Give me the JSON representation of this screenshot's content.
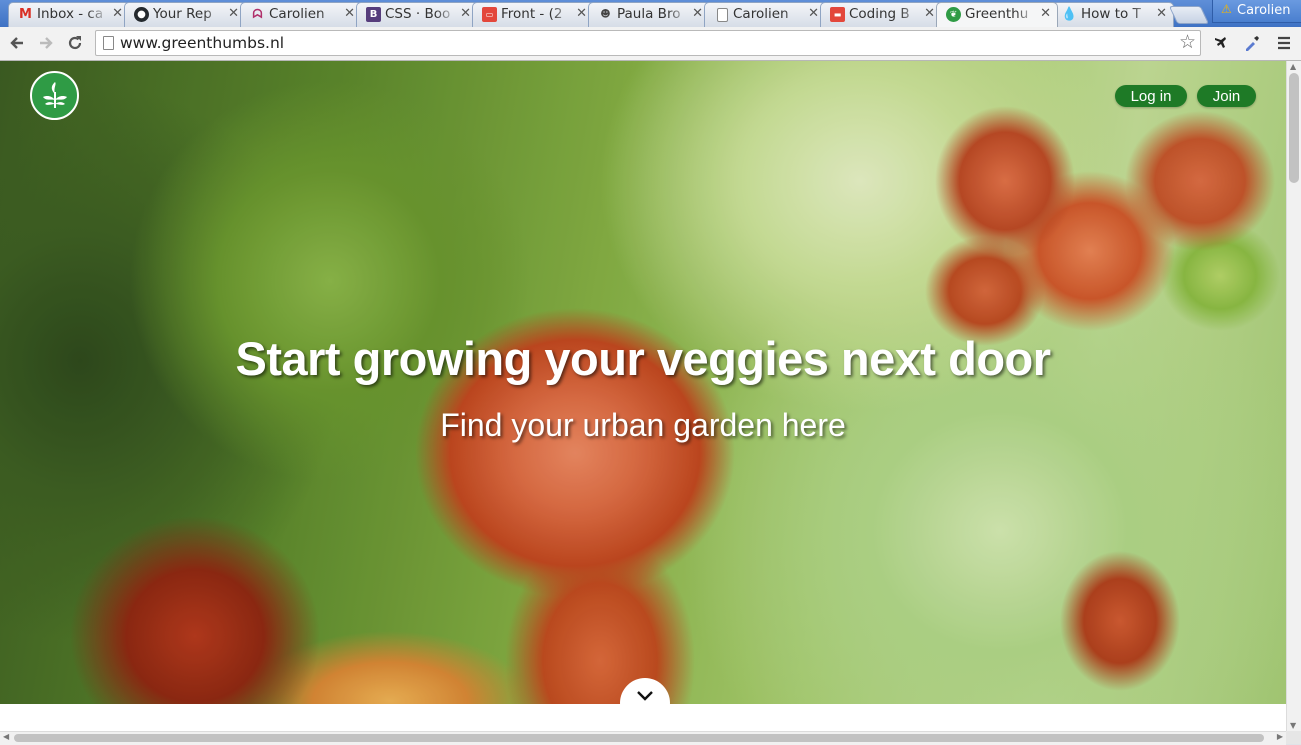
{
  "browser": {
    "tabs": [
      {
        "title": "Inbox - ca",
        "icon": "gmail-icon",
        "color": "#d93025"
      },
      {
        "title": "Your Rep",
        "icon": "github-icon",
        "color": "#24292e"
      },
      {
        "title": "Carolien",
        "icon": "moo-icon",
        "color": "#b0306b"
      },
      {
        "title": "CSS · Boo",
        "icon": "bootstrap-icon",
        "color": "#563d7c"
      },
      {
        "title": "Front - (2",
        "icon": "front-icon",
        "color": "#e3473b"
      },
      {
        "title": "Paula Bro",
        "icon": "owl-icon",
        "color": "#444444"
      },
      {
        "title": "Carolien",
        "icon": "page-icon",
        "color": "#777777"
      },
      {
        "title": "Coding B",
        "icon": "bus-icon",
        "color": "#e3473b"
      },
      {
        "title": "Greenthu",
        "icon": "greenthumbs-icon",
        "color": "#2f9b45",
        "active": true
      },
      {
        "title": "How to T",
        "icon": "drupal-icon",
        "color": "#0a79c0"
      }
    ],
    "profile_name": "Carolien",
    "url": "www.greenthumbs.nl"
  },
  "page": {
    "nav": {
      "login_label": "Log in",
      "join_label": "Join"
    },
    "hero": {
      "title": "Start growing your veggies next door",
      "subtitle": "Find your urban garden here"
    },
    "brand_color": "#1e7a26"
  }
}
